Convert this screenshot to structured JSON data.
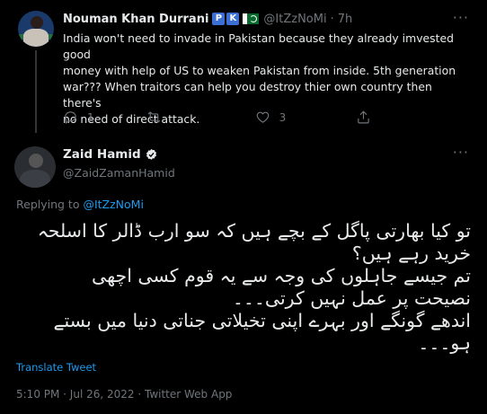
{
  "parent_tweet": {
    "author_name": "Nouman Khan Durrani",
    "badges": [
      "P",
      "K"
    ],
    "handle": "@ItZzNoMi",
    "separator": "·",
    "time": "7h",
    "more_icon": "more-horizontal-icon",
    "lines": [
      "India won't need to invade in Pakistan because they already imvested good",
      "money with help of US to weaken Pakistan from inside. 5th generation",
      "war??? When traitors can help you destroy thier own country then there's",
      "no need of direct attack."
    ],
    "actions": {
      "reply_count": "1",
      "retweet_count": "",
      "like_count": "3"
    }
  },
  "main_tweet": {
    "author_name": "Zaid Hamid",
    "handle": "@ZaidZamanHamid",
    "replying_prefix": "Replying to ",
    "replying_to": "@ItZzNoMi",
    "urdu_lines": [
      "تو کیا بھارتی پاگل کے بچے ہیں کہ سو ارب ڈالر کا اسلحہ",
      "خرید رہے ہیں؟",
      "تم جیسے جاہلوں کی وجہ سے یہ قوم کسی اچھی",
      "نصیحت پر عمل نہیں کرتی۔۔۔",
      "اندھے گونگے اور بہرے اپنی تخیلاتی جناتی دنیا میں بستے",
      "ہو۔۔۔"
    ],
    "translate_label": "Translate Tweet",
    "meta": "5:10 PM · Jul 26, 2022 · Twitter Web App"
  },
  "colors": {
    "background": "#000000",
    "text": "#e7e9ea",
    "muted": "#71767b",
    "accent": "#1d9bf0"
  }
}
